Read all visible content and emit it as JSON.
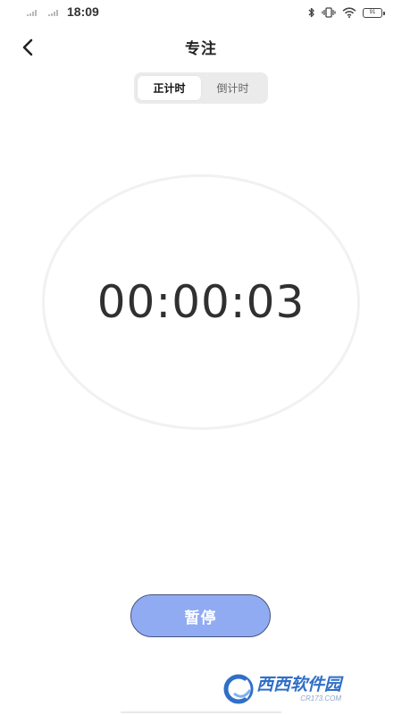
{
  "status_bar": {
    "time": "18:09",
    "battery_level": "91",
    "icons": [
      "signal-icon",
      "signal-icon",
      "bluetooth-icon",
      "vibrate-icon",
      "wifi-icon",
      "battery-icon"
    ]
  },
  "header": {
    "back_icon": "chevron-left-icon",
    "title": "专注"
  },
  "mode_tabs": [
    {
      "label": "正计时",
      "active": true
    },
    {
      "label": "倒计时",
      "active": false
    }
  ],
  "timer": {
    "display": "00:00:03"
  },
  "pause_button": {
    "label": "暂停"
  },
  "watermark": {
    "main": "西西软件园",
    "sub": "CR173.COM"
  },
  "colors": {
    "accent": "#91abf3",
    "button_border": "#46557d",
    "tab_background": "#ebebeb",
    "ring": "#f1f1f1",
    "watermark_blue": "#2f6fc8"
  }
}
